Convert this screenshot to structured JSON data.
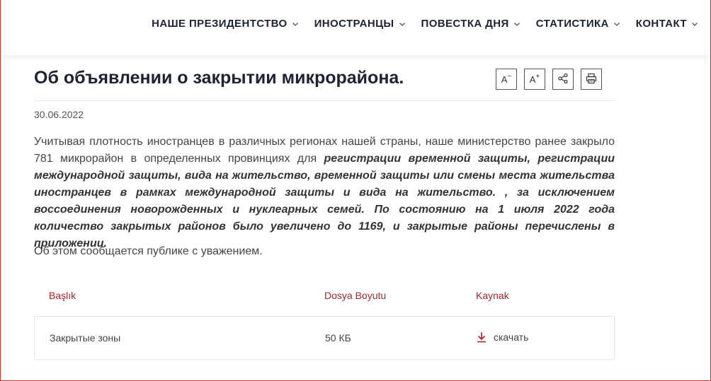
{
  "nav": {
    "items": [
      {
        "label": "НАШЕ ПРЕЗИДЕНТСТВО"
      },
      {
        "label": "ИНОСТРАНЦЫ"
      },
      {
        "label": "ПОВЕСТКА ДНЯ"
      },
      {
        "label": "СТАТИСТИКА"
      },
      {
        "label": "КОНТАКТ"
      }
    ]
  },
  "article": {
    "title": "Об объявлении о закрытии микрорайона.",
    "date": "30.06.2022",
    "para1_plain": "Учитывая плотность иностранцев в различных регионах нашей страны, наше министерство ранее закрыло 781 микрорайон в определенных провинциях для ",
    "para1_bold": "регистрации временной защиты, регистрации международной защиты, вида на жительство, временной защиты или смены места жительства иностранцев в рамках международной защиты и вида на жительство. , за исключением воссоединения новорожденных и нуклеарных семей. По состоянию на 1 июля 2022 года количество закрытых районов было увеличено до 1169, и закрытые районы перечислены в приложении.",
    "para2": "Об этом сообщается публике с уважением."
  },
  "tools": {
    "decrease_label": "A",
    "decrease_sign": "−",
    "increase_label": "A",
    "increase_sign": "+"
  },
  "table": {
    "headers": {
      "title": "Başlık",
      "size": "Dosya Boyutu",
      "source": "Kaynak"
    },
    "rows": [
      {
        "title": "Закрытые зоны",
        "size": "50 КБ",
        "action": "скачать"
      }
    ]
  },
  "colors": {
    "accent": "#a4262c",
    "nav_text": "#1c2434",
    "frame": "#c0392b"
  }
}
